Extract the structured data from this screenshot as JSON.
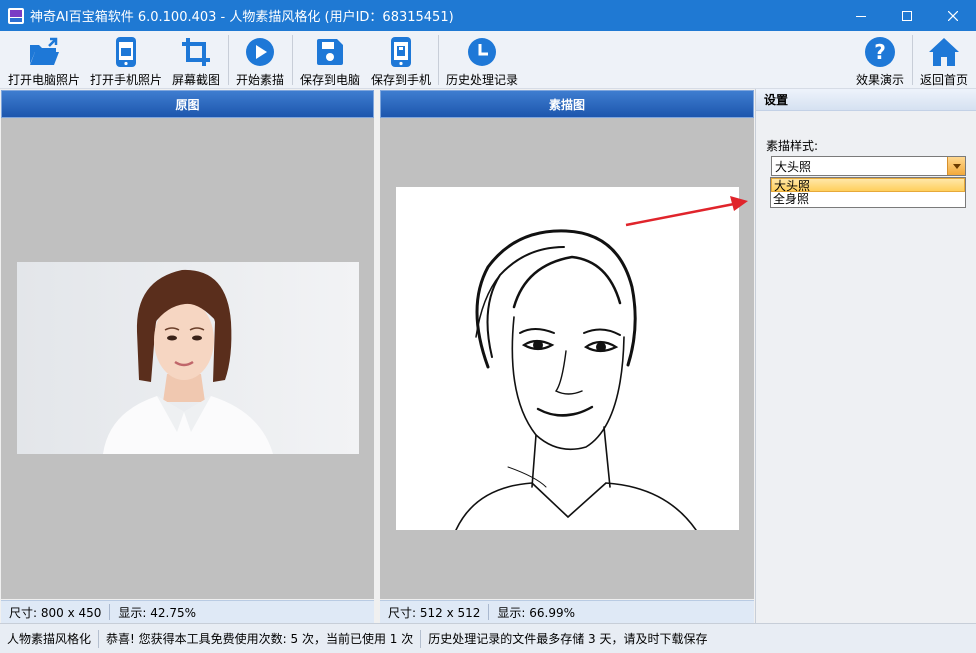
{
  "window": {
    "title": "神奇AI百宝箱软件 6.0.100.403 - 人物素描风格化 (用户ID：68315451)"
  },
  "toolbar": {
    "open_pc": "打开电脑照片",
    "open_phone": "打开手机照片",
    "screenshot": "屏幕截图",
    "start_sketch": "开始素描",
    "save_pc": "保存到电脑",
    "save_phone": "保存到手机",
    "history": "历史处理记录",
    "demo": "效果演示",
    "home": "返回首页"
  },
  "colors": {
    "accent": "#1e78d7",
    "titlebar": "#1f79d3",
    "arrow": "#e0242b"
  },
  "original_panel": {
    "title": "原图",
    "size_text": "尺寸: 800 x 450",
    "zoom_text": "显示: 42.75%"
  },
  "sketch_panel": {
    "title": "素描图",
    "size_text": "尺寸: 512 x 512",
    "zoom_text": "显示: 66.99%"
  },
  "settings": {
    "title": "设置",
    "style_label": "素描样式:",
    "selected": "大头照",
    "options": [
      "大头照",
      "全身照"
    ]
  },
  "statusbar": {
    "tool_name": "人物素描风格化",
    "usage": "恭喜! 您获得本工具免费使用次数: 5 次，当前已使用 1 次",
    "history_note": "历史处理记录的文件最多存储 3 天，请及时下载保存"
  }
}
